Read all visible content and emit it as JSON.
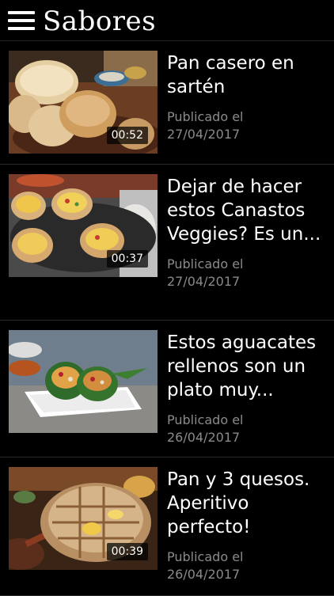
{
  "appbar": {
    "title": "Sabores",
    "menu_icon": "hamburger-menu-icon"
  },
  "videos": [
    {
      "title": "Pan casero en sartén",
      "published_label": "Publicado el",
      "date": "27/04/2017",
      "duration": "00:52"
    },
    {
      "title": "Dejar de hacer estos Canastos Veggies? Es un...",
      "published_label": "Publicado el",
      "date": "27/04/2017",
      "duration": "00:37"
    },
    {
      "title": "Estos aguacates rellenos son un plato muy...",
      "published_label": "Publicado el",
      "date": "26/04/2017",
      "duration": ""
    },
    {
      "title": "Pan y 3 quesos. Aperitivo perfecto!",
      "published_label": "Publicado el",
      "date": "26/04/2017",
      "duration": "00:39"
    }
  ]
}
